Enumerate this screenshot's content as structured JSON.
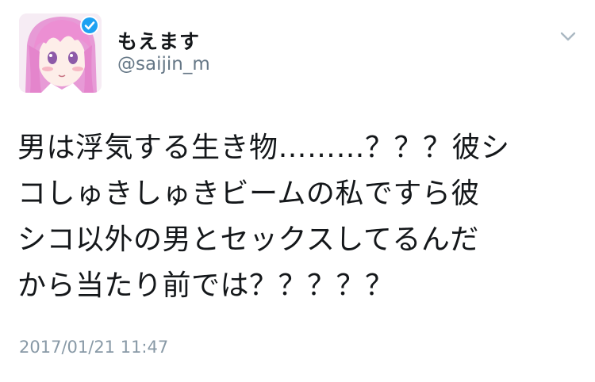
{
  "tweet": {
    "author": {
      "display_name": "もえます",
      "handle": "@saijin_m",
      "verified": true
    },
    "text_lines": [
      "男は浮気する生き物………？？？彼シ",
      "コしゅきしゅきビームの私ですら彼",
      "シコ以外の男とセックスしてるんだ",
      "から当たり前では？？？？？"
    ],
    "timestamp": "2017/01/21 11:47",
    "menu_icon": "chevron-down-icon"
  },
  "colors": {
    "verified_badge": "#1da1f2",
    "handle": "#657786",
    "timestamp": "#8899a6",
    "text": "#14171a",
    "avatar_hair": "#e98ccf"
  }
}
